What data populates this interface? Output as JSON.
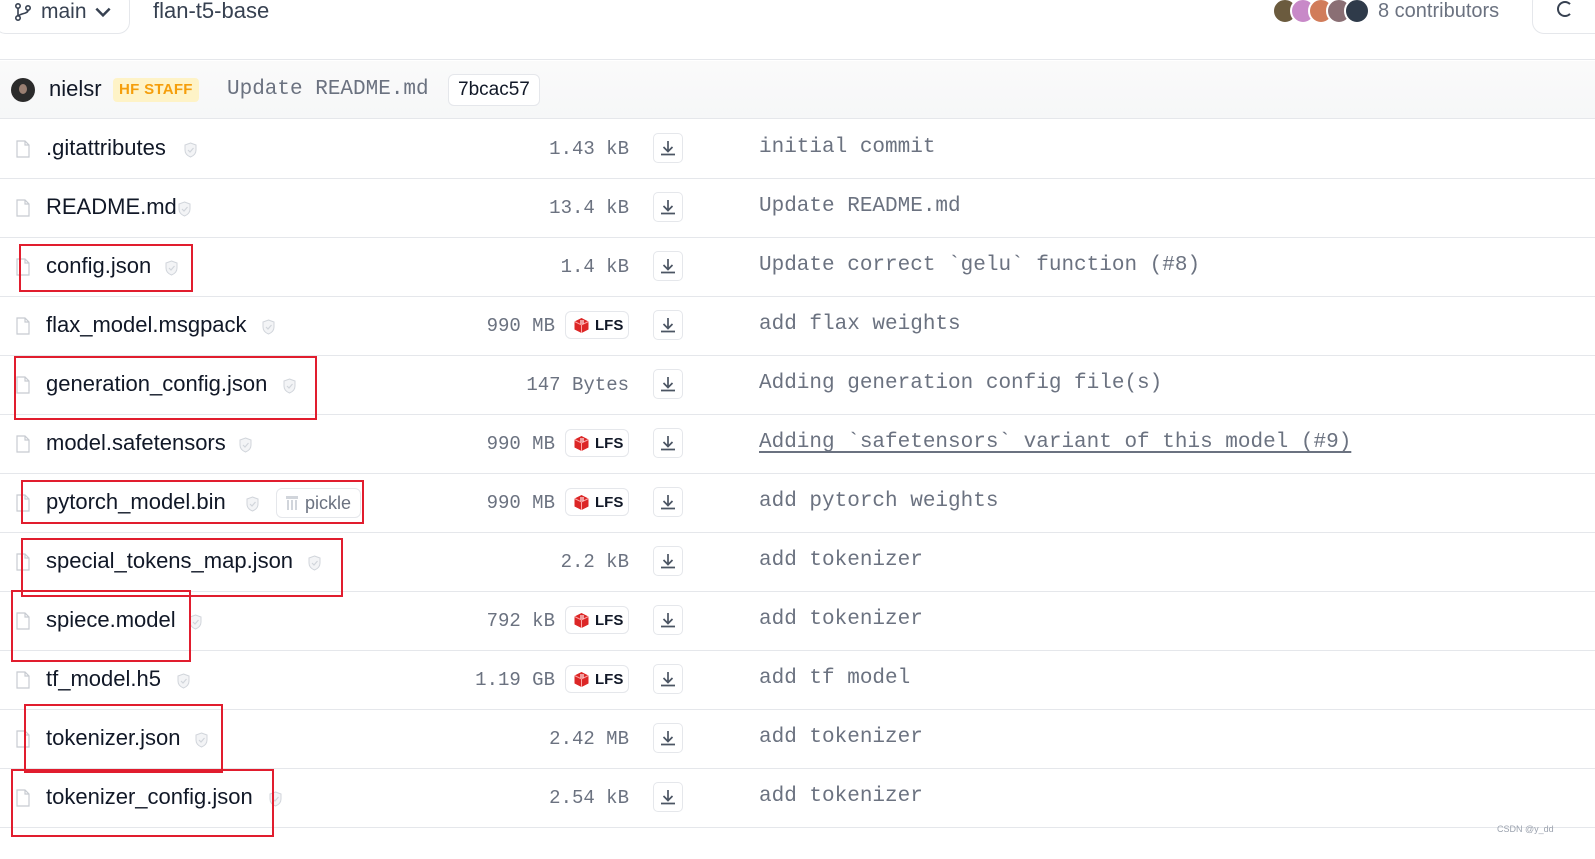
{
  "header": {
    "branch": "main",
    "repo_name": "flan-t5-base",
    "contributors_label": "8 contributors",
    "avatar_colors": [
      "#6b5b3e",
      "#c889c8",
      "#d17c5a",
      "#8a6f74",
      "#2f3b4a"
    ]
  },
  "commit": {
    "author": "nielsr",
    "badge": "HF STAFF",
    "message": "Update README.md",
    "hash": "7bcac57"
  },
  "files": [
    {
      "name": ".gitattributes",
      "size": "1.43 kB",
      "lfs": false,
      "pickle": false,
      "commit": "initial commit",
      "commit_linked": false
    },
    {
      "name": "README.md",
      "size": "13.4 kB",
      "lfs": false,
      "pickle": false,
      "commit": "Update README.md",
      "commit_linked": false
    },
    {
      "name": "config.json",
      "size": "1.4 kB",
      "lfs": false,
      "pickle": false,
      "commit": "Update correct `gelu` function (#8)",
      "commit_linked": false
    },
    {
      "name": "flax_model.msgpack",
      "size": "990 MB",
      "lfs": true,
      "pickle": false,
      "commit": "add flax weights",
      "commit_linked": false
    },
    {
      "name": "generation_config.json",
      "size": "147 Bytes",
      "lfs": false,
      "pickle": false,
      "commit": "Adding generation config file(s)",
      "commit_linked": false
    },
    {
      "name": "model.safetensors",
      "size": "990 MB",
      "lfs": true,
      "pickle": false,
      "commit": "Adding `safetensors` variant of this model (#9)",
      "commit_linked": true
    },
    {
      "name": "pytorch_model.bin",
      "size": "990 MB",
      "lfs": true,
      "pickle": true,
      "commit": "add pytorch weights",
      "commit_linked": false
    },
    {
      "name": "special_tokens_map.json",
      "size": "2.2 kB",
      "lfs": false,
      "pickle": false,
      "commit": "add tokenizer",
      "commit_linked": false
    },
    {
      "name": "spiece.model",
      "size": "792 kB",
      "lfs": true,
      "pickle": false,
      "commit": "add tokenizer",
      "commit_linked": false
    },
    {
      "name": "tf_model.h5",
      "size": "1.19 GB",
      "lfs": true,
      "pickle": false,
      "commit": "add tf model",
      "commit_linked": false
    },
    {
      "name": "tokenizer.json",
      "size": "2.42 MB",
      "lfs": false,
      "pickle": false,
      "commit": "add tokenizer",
      "commit_linked": false
    },
    {
      "name": "tokenizer_config.json",
      "size": "2.54 kB",
      "lfs": false,
      "pickle": false,
      "commit": "add tokenizer",
      "commit_linked": false
    }
  ],
  "labels": {
    "lfs": "LFS",
    "pickle": "pickle"
  },
  "highlighted_files": [
    "config.json",
    "generation_config.json",
    "pytorch_model.bin",
    "special_tokens_map.json",
    "spiece.model",
    "tokenizer.json",
    "tokenizer_config.json"
  ],
  "highlight_color": "#e11d2e",
  "watermark": "CSDN @y_dd"
}
